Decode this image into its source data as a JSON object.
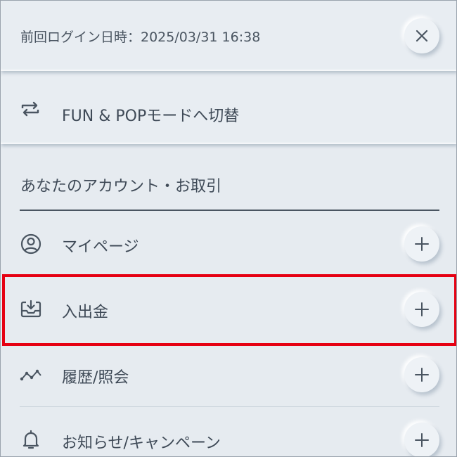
{
  "header": {
    "last_login": "前回ログイン日時：2025/03/31 16:38",
    "close_icon": "close-icon"
  },
  "mode_switch": {
    "label": "FUN & POPモードへ切替",
    "icon": "repeat-icon"
  },
  "account_section": {
    "title": "あなたのアカウント・お取引",
    "items": [
      {
        "label": "マイページ",
        "icon": "user-circle-icon",
        "action_icon": "plus-icon"
      },
      {
        "label": "入出金",
        "icon": "inbox-download-icon",
        "action_icon": "plus-icon"
      },
      {
        "label": "履歴/照会",
        "icon": "trend-icon",
        "action_icon": "plus-icon"
      },
      {
        "label": "お知らせ/キャンペーン",
        "icon": "bell-icon",
        "action_icon": "plus-icon"
      }
    ]
  },
  "colors": {
    "background": "#e6ebf0",
    "text": "#3f4a57",
    "highlight": "#e60012"
  }
}
